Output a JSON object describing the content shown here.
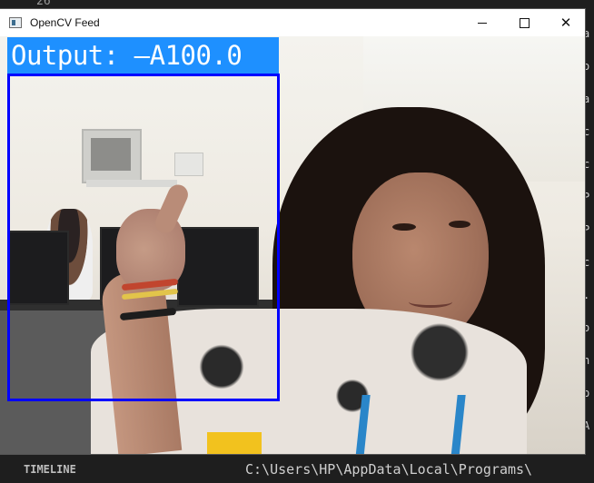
{
  "window": {
    "title": "OpenCV Feed",
    "buttons": {
      "minimize": "minimize",
      "maximize": "maximize",
      "close": "✕"
    }
  },
  "overlay": {
    "output_text": "Output: —A100.0",
    "label_bg_color": "#1e90ff",
    "box_color": "#0000ff"
  },
  "background_ide": {
    "top_text": "26",
    "bottom_left_text": "TIMELINE",
    "bottom_right_text": "C:\\Users\\HP\\AppData\\Local\\Programs\\",
    "right_edge_chars": [
      "a",
      "o",
      "a",
      "c",
      "c",
      "P",
      "P",
      "c",
      ".",
      "o",
      "h",
      "p",
      "A"
    ]
  }
}
